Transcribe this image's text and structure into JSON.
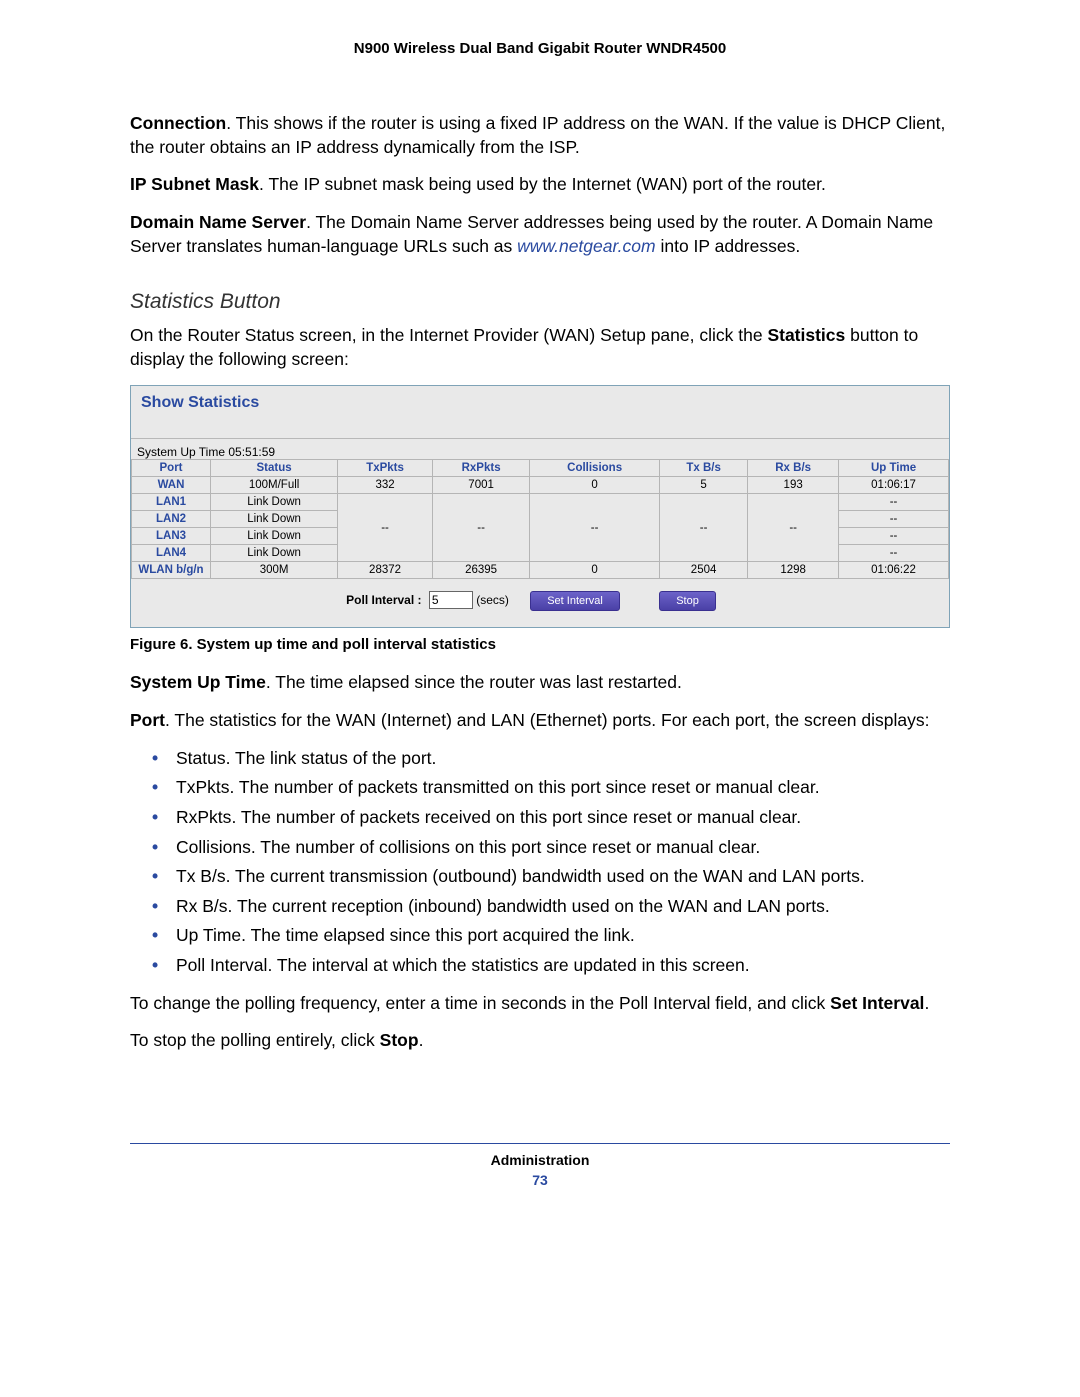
{
  "header": {
    "product_title": "N900 Wireless Dual Band Gigabit Router WNDR4500"
  },
  "paragraphs": {
    "connection_label": "Connection",
    "connection_text": ". This shows if the router is using a fixed IP address on the WAN. If the value is DHCP Client, the router obtains an IP address dynamically from the ISP.",
    "ip_subnet_label": "IP Subnet Mask",
    "ip_subnet_text": ". The IP subnet mask being used by the Internet (WAN) port of the router.",
    "dns_label": "Domain Name Server",
    "dns_text_pre": ". The Domain Name Server addresses being used by the router. A Domain Name Server translates human-language URLs such as ",
    "dns_link": "www.netgear.com",
    "dns_text_post": " into IP addresses.",
    "stats_intro_pre": "On the Router Status screen, in the Internet Provider (WAN) Setup pane, click the ",
    "stats_intro_bold": "Statistics",
    "stats_intro_post": " button to display the following screen:",
    "uptime_label": "System Up Time",
    "uptime_text": ". The time elapsed since the router was last restarted.",
    "port_label": "Port",
    "port_text": ". The statistics for the WAN (Internet) and LAN (Ethernet) ports. For each port, the screen displays:",
    "poll_change_text": "To change the polling frequency, enter a time in seconds in the Poll Interval field, and click ",
    "poll_change_bold": "Set Interval",
    "stop_text_pre": "To stop the polling entirely, click ",
    "stop_text_bold": "Stop"
  },
  "section_title": "Statistics Button",
  "panel": {
    "title": "Show Statistics",
    "uptime_label": "System Up Time",
    "uptime_value": "05:51:59",
    "headers": {
      "port": "Port",
      "status": "Status",
      "txpkts": "TxPkts",
      "rxpkts": "RxPkts",
      "collisions": "Collisions",
      "txbs": "Tx B/s",
      "rxbs": "Rx B/s",
      "uptime": "Up Time"
    },
    "rows": {
      "wan": {
        "port": "WAN",
        "status": "100M/Full",
        "tx": "332",
        "rx": "7001",
        "col": "0",
        "txbs": "5",
        "rxbs": "193",
        "up": "01:06:17"
      },
      "lan1": {
        "port": "LAN1",
        "status": "Link Down",
        "up": "--"
      },
      "lan2": {
        "port": "LAN2",
        "status": "Link Down",
        "up": "--"
      },
      "lan3": {
        "port": "LAN3",
        "status": "Link Down",
        "up": "--"
      },
      "lan4": {
        "port": "LAN4",
        "status": "Link Down",
        "up": "--"
      },
      "lan_group": {
        "tx": "--",
        "rx": "--",
        "col": "--",
        "txbs": "--",
        "rxbs": "--"
      },
      "wlan": {
        "port": "WLAN b/g/n",
        "status": "300M",
        "tx": "28372",
        "rx": "26395",
        "col": "0",
        "txbs": "2504",
        "rxbs": "1298",
        "up": "01:06:22"
      }
    },
    "poll_label": "Poll Interval :",
    "poll_value": "5",
    "poll_unit": "(secs)",
    "btn_set": "Set Interval",
    "btn_stop": "Stop"
  },
  "figure_caption": "Figure 6. System up time and poll interval statistics",
  "bullets": {
    "status_b": "Status",
    "status_t": ". The link status of the port.",
    "txpkts_b": "TxPkts",
    "txpkts_t": ". The number of packets transmitted on this port since reset or manual clear.",
    "rxpkts_b": "RxPkts",
    "rxpkts_t": ". The number of packets received on this port since reset or manual clear.",
    "coll_b": "Collisions",
    "coll_t": ". The number of collisions on this port since reset or manual clear.",
    "txbs_b": "Tx B/s",
    "txbs_t": ". The current transmission (outbound) bandwidth used on the WAN and LAN ports.",
    "rxbs_b": "Rx B/s",
    "rxbs_t": ". The current reception (inbound) bandwidth used on the WAN and LAN ports.",
    "uptime_b": "Up Time",
    "uptime_t": ". The time elapsed since this port acquired the link.",
    "poll_b": "Poll Interval",
    "poll_t": ". The interval at which the statistics are updated in this screen."
  },
  "footer": {
    "section": "Administration",
    "page_number": "73"
  }
}
